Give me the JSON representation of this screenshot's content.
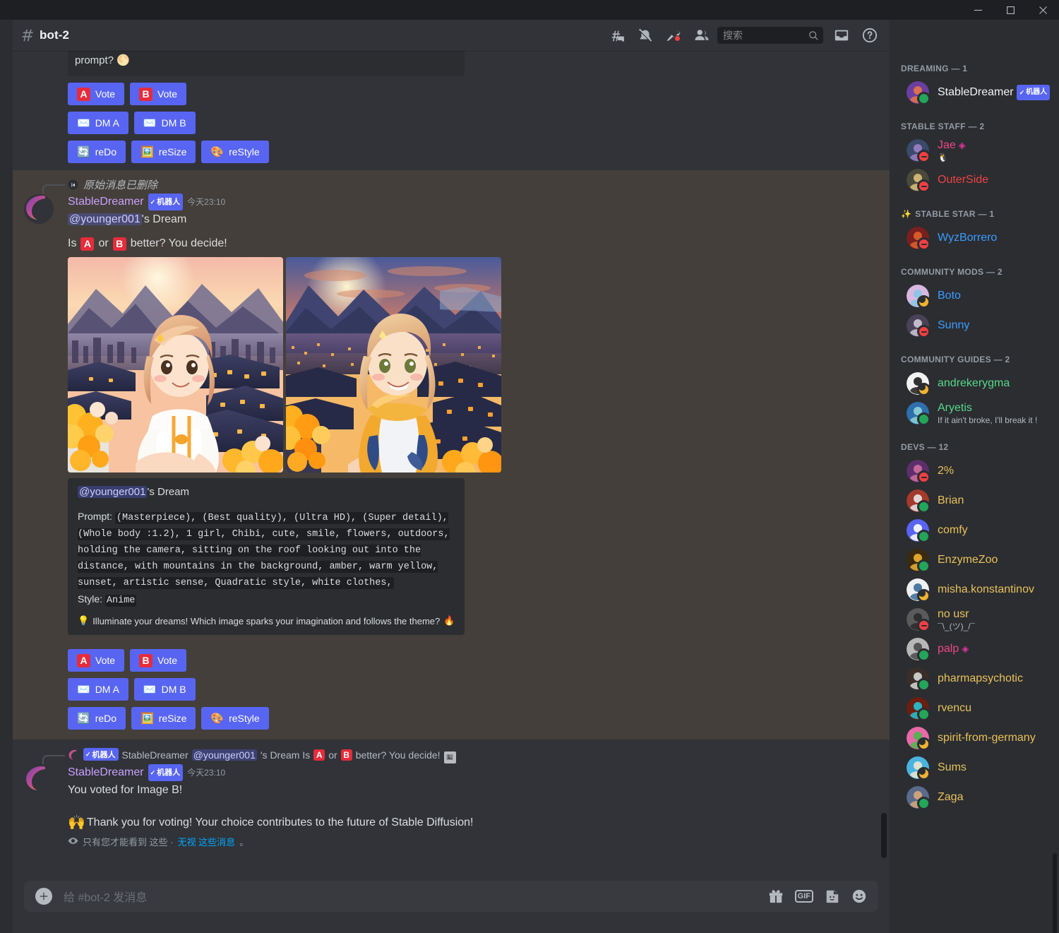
{
  "window": {
    "minimize": "minimize",
    "maximize": "maximize",
    "close": "close"
  },
  "header": {
    "channel_name": "bot-2",
    "hash_icon": "hash-icon",
    "icons": [
      {
        "name": "threads-icon",
        "label": "Threads"
      },
      {
        "name": "notification-off-icon",
        "label": "Notification Settings"
      },
      {
        "name": "pinned-messages-icon",
        "label": "Pinned Messages"
      },
      {
        "name": "member-list-icon",
        "label": "Member List"
      }
    ],
    "search": {
      "placeholder": "搜索",
      "value": "",
      "icon": "search-icon"
    },
    "inbox_icon": "inbox-icon",
    "help_icon": "help-icon"
  },
  "top_block": {
    "quote_text": "prompt? 🌕",
    "buttons": [
      [
        {
          "badge": "A",
          "label": "Vote",
          "name": "vote-a-button"
        },
        {
          "badge": "B",
          "label": "Vote",
          "name": "vote-b-button"
        }
      ],
      [
        {
          "emoji": "✉️",
          "label": "DM A",
          "name": "dm-a-button"
        },
        {
          "emoji": "✉️",
          "label": "DM B",
          "name": "dm-b-button"
        }
      ],
      [
        {
          "emoji": "🔄",
          "label": "reDo",
          "name": "redo-button"
        },
        {
          "emoji": "🖼️",
          "label": "reSize",
          "name": "resize-button"
        },
        {
          "emoji": "🎨",
          "label": "reStyle",
          "name": "restyle-button"
        }
      ]
    ]
  },
  "main_message": {
    "reply_deleted_text": "原始消息已删除",
    "author": "StableDreamer",
    "bot_tag": "机器人",
    "timestamp": "今天23:10",
    "dream_line_mention": "@younger001",
    "dream_line_rest": "'s Dream",
    "question_prefix": "Is",
    "badge_a": "A",
    "question_mid": "or",
    "badge_b": "B",
    "question_suffix": "better? You decide!",
    "images": [
      {
        "name": "generated-image-a",
        "alt": "Anime girl in white hoodie on rooftop at sunset"
      },
      {
        "name": "generated-image-b",
        "alt": "Anime girl in yellow jacket on rooftop at sunset"
      }
    ],
    "panel": {
      "title_mention": "@younger001",
      "title_rest": "'s Dream",
      "prompt_label": "Prompt:",
      "prompt_text": "(Masterpiece), (Best quality), (Ultra HD), (Super detail), (Whole body :1.2), 1 girl, Chibi, cute, smile, flowers, outdoors, holding the camera, sitting on the roof looking out into the distance, with mountains in the background, amber, warm yellow, sunset, artistic sense, Quadratic style, white clothes,",
      "style_label": "Style:",
      "style_value": "Anime",
      "footer_emoji_left": "💡",
      "footer_text": "Illuminate your dreams! Which image sparks your imagination and follows the theme?",
      "footer_emoji_right": "🔥"
    },
    "buttons": [
      [
        {
          "badge": "A",
          "label": "Vote",
          "name": "vote-a-button"
        },
        {
          "badge": "B",
          "label": "Vote",
          "name": "vote-b-button"
        }
      ],
      [
        {
          "emoji": "✉️",
          "label": "DM A",
          "name": "dm-a-button"
        },
        {
          "emoji": "✉️",
          "label": "DM B",
          "name": "dm-b-button"
        }
      ],
      [
        {
          "emoji": "🔄",
          "label": "reDo",
          "name": "redo-button"
        },
        {
          "emoji": "🖼️",
          "label": "reSize",
          "name": "resize-button"
        },
        {
          "emoji": "🎨",
          "label": "reStyle",
          "name": "restyle-button"
        }
      ]
    ]
  },
  "vote_message": {
    "reply_bot_tag": "机器人",
    "reply_author": "StableDreamer",
    "reply_mention": "@younger001",
    "reply_text_a": "'s Dream Is",
    "reply_badge_a": "A",
    "reply_text_b": "or",
    "reply_badge_b": "B",
    "reply_text_c": "better? You decide!",
    "author": "StableDreamer",
    "bot_tag": "机器人",
    "timestamp": "今天23:10",
    "body_line": "You voted for Image B!",
    "thanks_emoji": "🙌",
    "thanks_text": "Thank you for voting! Your choice contributes to the future of Stable Diffusion!",
    "ephemeral_prefix": "只有您才能看到 这些 ·",
    "ephemeral_link": "无视 这些消息",
    "ephemeral_suffix": "。"
  },
  "composer": {
    "placeholder": "给 #bot-2 发消息",
    "plus_icon": "add-attachment-icon",
    "gift_icon": "gift-icon",
    "gif_label": "GIF",
    "sticker_icon": "sticker-icon",
    "emoji_icon": "emoji-icon"
  },
  "members": {
    "groups": [
      {
        "title": "DREAMING — 1",
        "icon": null,
        "users": [
          {
            "name": "StableDreamer",
            "color": "#f2f3f5",
            "status": "online",
            "bot": "机器人",
            "avatar": "#6b3fa0",
            "avatar2": "#e8734a",
            "sub": null
          }
        ]
      },
      {
        "title": "STABLE STAFF — 2",
        "icon": null,
        "users": [
          {
            "name": "Jae",
            "color": "#ed4887",
            "status": "dnd",
            "gem": true,
            "avatar": "#3b4a6b",
            "avatar2": "#9f7fc4",
            "sub": "🐧"
          },
          {
            "name": "OuterSide",
            "color": "#ed4245",
            "status": "dnd",
            "avatar": "#4a4a3a",
            "avatar2": "#d9c27a",
            "sub": null
          }
        ]
      },
      {
        "title": "STABLE STAR — 1",
        "icon": "✨",
        "users": [
          {
            "name": "WyzBorrero",
            "color": "#3b9dff",
            "status": "dnd",
            "avatar": "#7a1f1f",
            "avatar2": "#e0602a",
            "sub": null
          }
        ]
      },
      {
        "title": "COMMUNITY MODS — 2",
        "icon": null,
        "users": [
          {
            "name": "Boto",
            "color": "#3b9dff",
            "status": "idle",
            "avatar": "#d8b8e0",
            "avatar2": "#86c7e8",
            "sub": null
          },
          {
            "name": "Sunny",
            "color": "#3b9dff",
            "status": "dnd",
            "avatar": "#4a4256",
            "avatar2": "#cfc8d8",
            "sub": null
          }
        ]
      },
      {
        "title": "COMMUNITY GUIDES — 2",
        "icon": null,
        "users": [
          {
            "name": "andrekerygma",
            "color": "#57d98a",
            "status": "idle",
            "avatar": "#f2f2f2",
            "avatar2": "#1c1c1c",
            "sub": null
          },
          {
            "name": "Aryetis",
            "color": "#57d98a",
            "status": "online",
            "avatar": "#2f6fae",
            "avatar2": "#8fd4d6",
            "sub": "If it ain't broke, I'll break it !"
          }
        ]
      },
      {
        "title": "DEVS — 12",
        "icon": null,
        "users": [
          {
            "name": "2%",
            "color": "#e8c15a",
            "status": "dnd",
            "avatar": "#5c2f6b",
            "avatar2": "#d06fa0",
            "sub": null
          },
          {
            "name": "Brian",
            "color": "#e8c15a",
            "status": "online",
            "avatar": "#a33b2a",
            "avatar2": "#e8e8e8",
            "sub": null
          },
          {
            "name": "comfy",
            "color": "#e8c15a",
            "status": "online",
            "avatar": "#5865f2",
            "avatar2": "#ffffff",
            "sub": null
          },
          {
            "name": "EnzymeZoo",
            "color": "#e8c15a",
            "status": "online",
            "avatar": "#3a2a10",
            "avatar2": "#f0b132",
            "sub": null
          },
          {
            "name": "misha.konstantinov",
            "color": "#e8c15a",
            "status": "idle",
            "avatar": "#f0f0f0",
            "avatar2": "#3a6a9a",
            "sub": null
          },
          {
            "name": "no usr",
            "color": "#e8c15a",
            "status": "dnd",
            "avatar": "#5a5a5a",
            "avatar2": "#2a2a2a",
            "sub": "¯\\_(ツ)_/¯"
          },
          {
            "name": "palp",
            "color": "#ed4887",
            "status": "online",
            "gem": true,
            "avatar": "#b8b8b8",
            "avatar2": "#4a4a4a",
            "sub": null
          },
          {
            "name": "pharmapsychotic",
            "color": "#e8c15a",
            "status": "online",
            "avatar": "#3a2f28",
            "avatar2": "#d8d8d8",
            "sub": null
          },
          {
            "name": "rvencu",
            "color": "#e8c15a",
            "status": "online",
            "avatar": "#6b1f10",
            "avatar2": "#25c4d8",
            "sub": null
          },
          {
            "name": "spirit-from-germany",
            "color": "#e8c15a",
            "status": "idle",
            "avatar": "#e86aa8",
            "avatar2": "#4ab84a",
            "sub": null
          },
          {
            "name": "Sums",
            "color": "#e8c15a",
            "status": "idle",
            "avatar": "#4ab4e0",
            "avatar2": "#f0e8d0",
            "sub": null
          },
          {
            "name": "Zaga",
            "color": "#e8c15a",
            "status": "online",
            "avatar": "#5a6a8a",
            "avatar2": "#d8a878",
            "sub": null
          }
        ]
      }
    ]
  }
}
